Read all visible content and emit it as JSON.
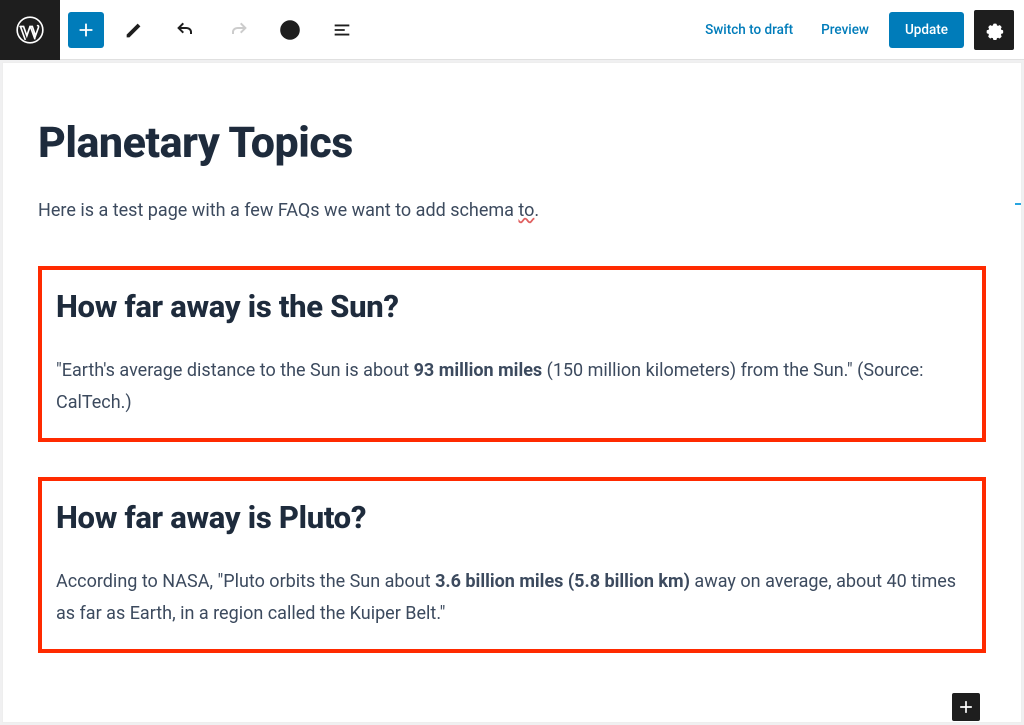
{
  "toolbar": {
    "switch_to_draft": "Switch to draft",
    "preview": "Preview",
    "update": "Update"
  },
  "page": {
    "title": "Planetary Topics",
    "intro_pre": "Here is a test page with a few FAQs we want to add schema ",
    "intro_spell": "to",
    "intro_post": "."
  },
  "faqs": [
    {
      "heading": "How far away is the Sun?",
      "a_pre": "\"Earth's average distance to the Sun is about ",
      "a_bold": "93 million miles",
      "a_post": " (150 million kilometers) from the Sun.\" (Source: CalTech.)"
    },
    {
      "heading": "How far away is Pluto?",
      "a_pre": "According to NASA, \"Pluto orbits the Sun about ",
      "a_bold": "3.6 billion miles (5.8 billion km)",
      "a_post": " away on average, about 40 times as far as Earth, in a region called the Kuiper Belt.\""
    }
  ]
}
